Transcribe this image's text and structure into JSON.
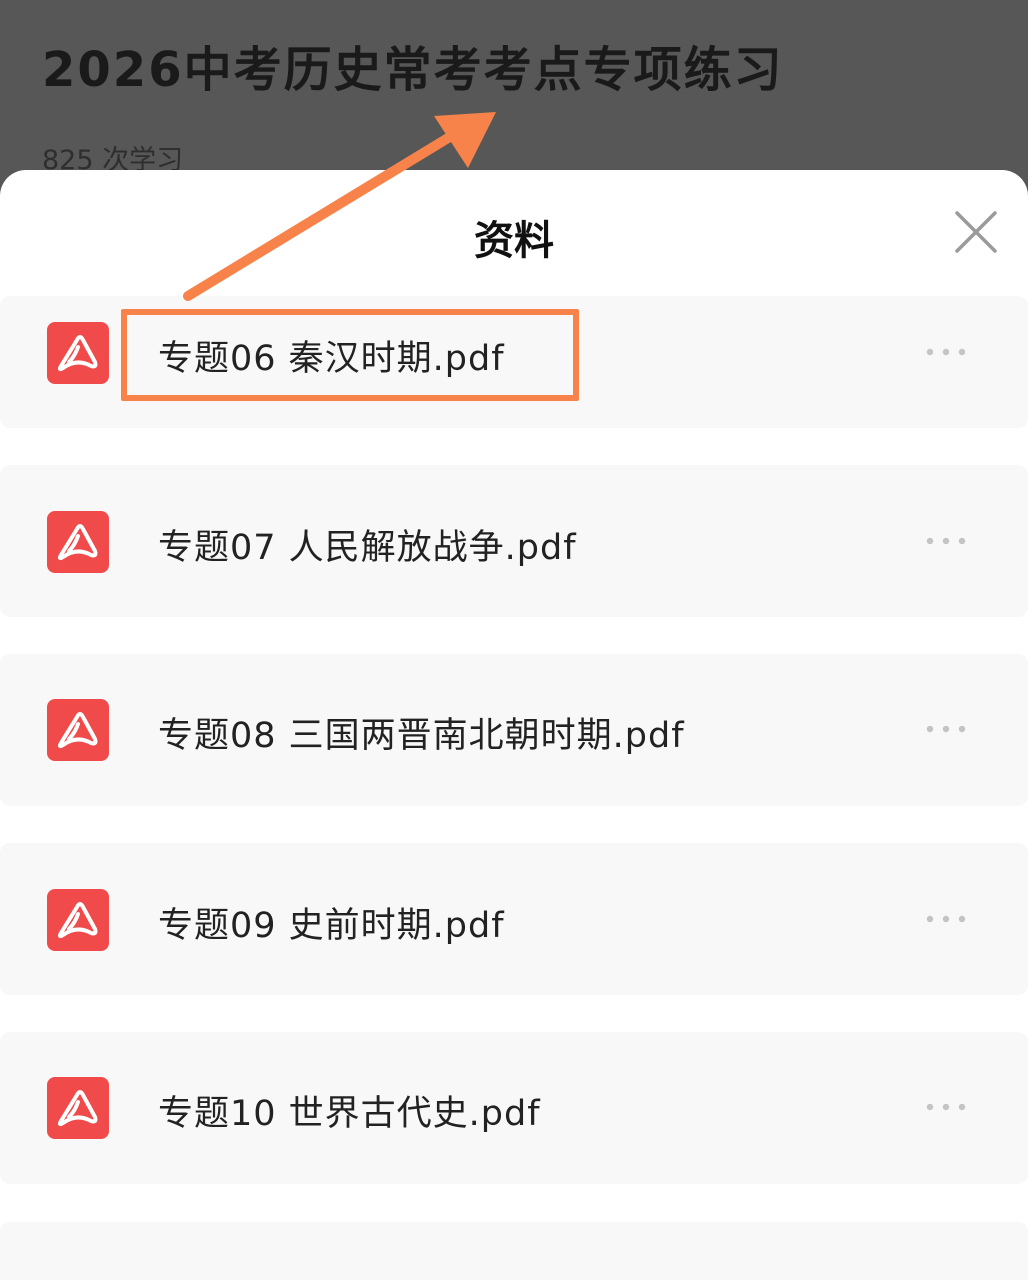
{
  "background": {
    "course_title": "2026中考历史常考考点专项练习",
    "study_count": "825 次学习"
  },
  "sheet": {
    "title": "资料",
    "close_icon": "close-icon",
    "files": [
      {
        "name": "专题06 秦汉时期.pdf",
        "icon": "pdf-icon",
        "highlighted": true
      },
      {
        "name": "专题07 人民解放战争.pdf",
        "icon": "pdf-icon",
        "highlighted": false
      },
      {
        "name": "专题08 三国两晋南北朝时期.pdf",
        "icon": "pdf-icon",
        "highlighted": false
      },
      {
        "name": "专题09 史前时期.pdf",
        "icon": "pdf-icon",
        "highlighted": false
      },
      {
        "name": "专题10 世界古代史.pdf",
        "icon": "pdf-icon",
        "highlighted": false
      }
    ]
  },
  "colors": {
    "pdf_icon": "#f04a4a",
    "annotation": "#f7834a",
    "dim_overlay": "#575757"
  }
}
